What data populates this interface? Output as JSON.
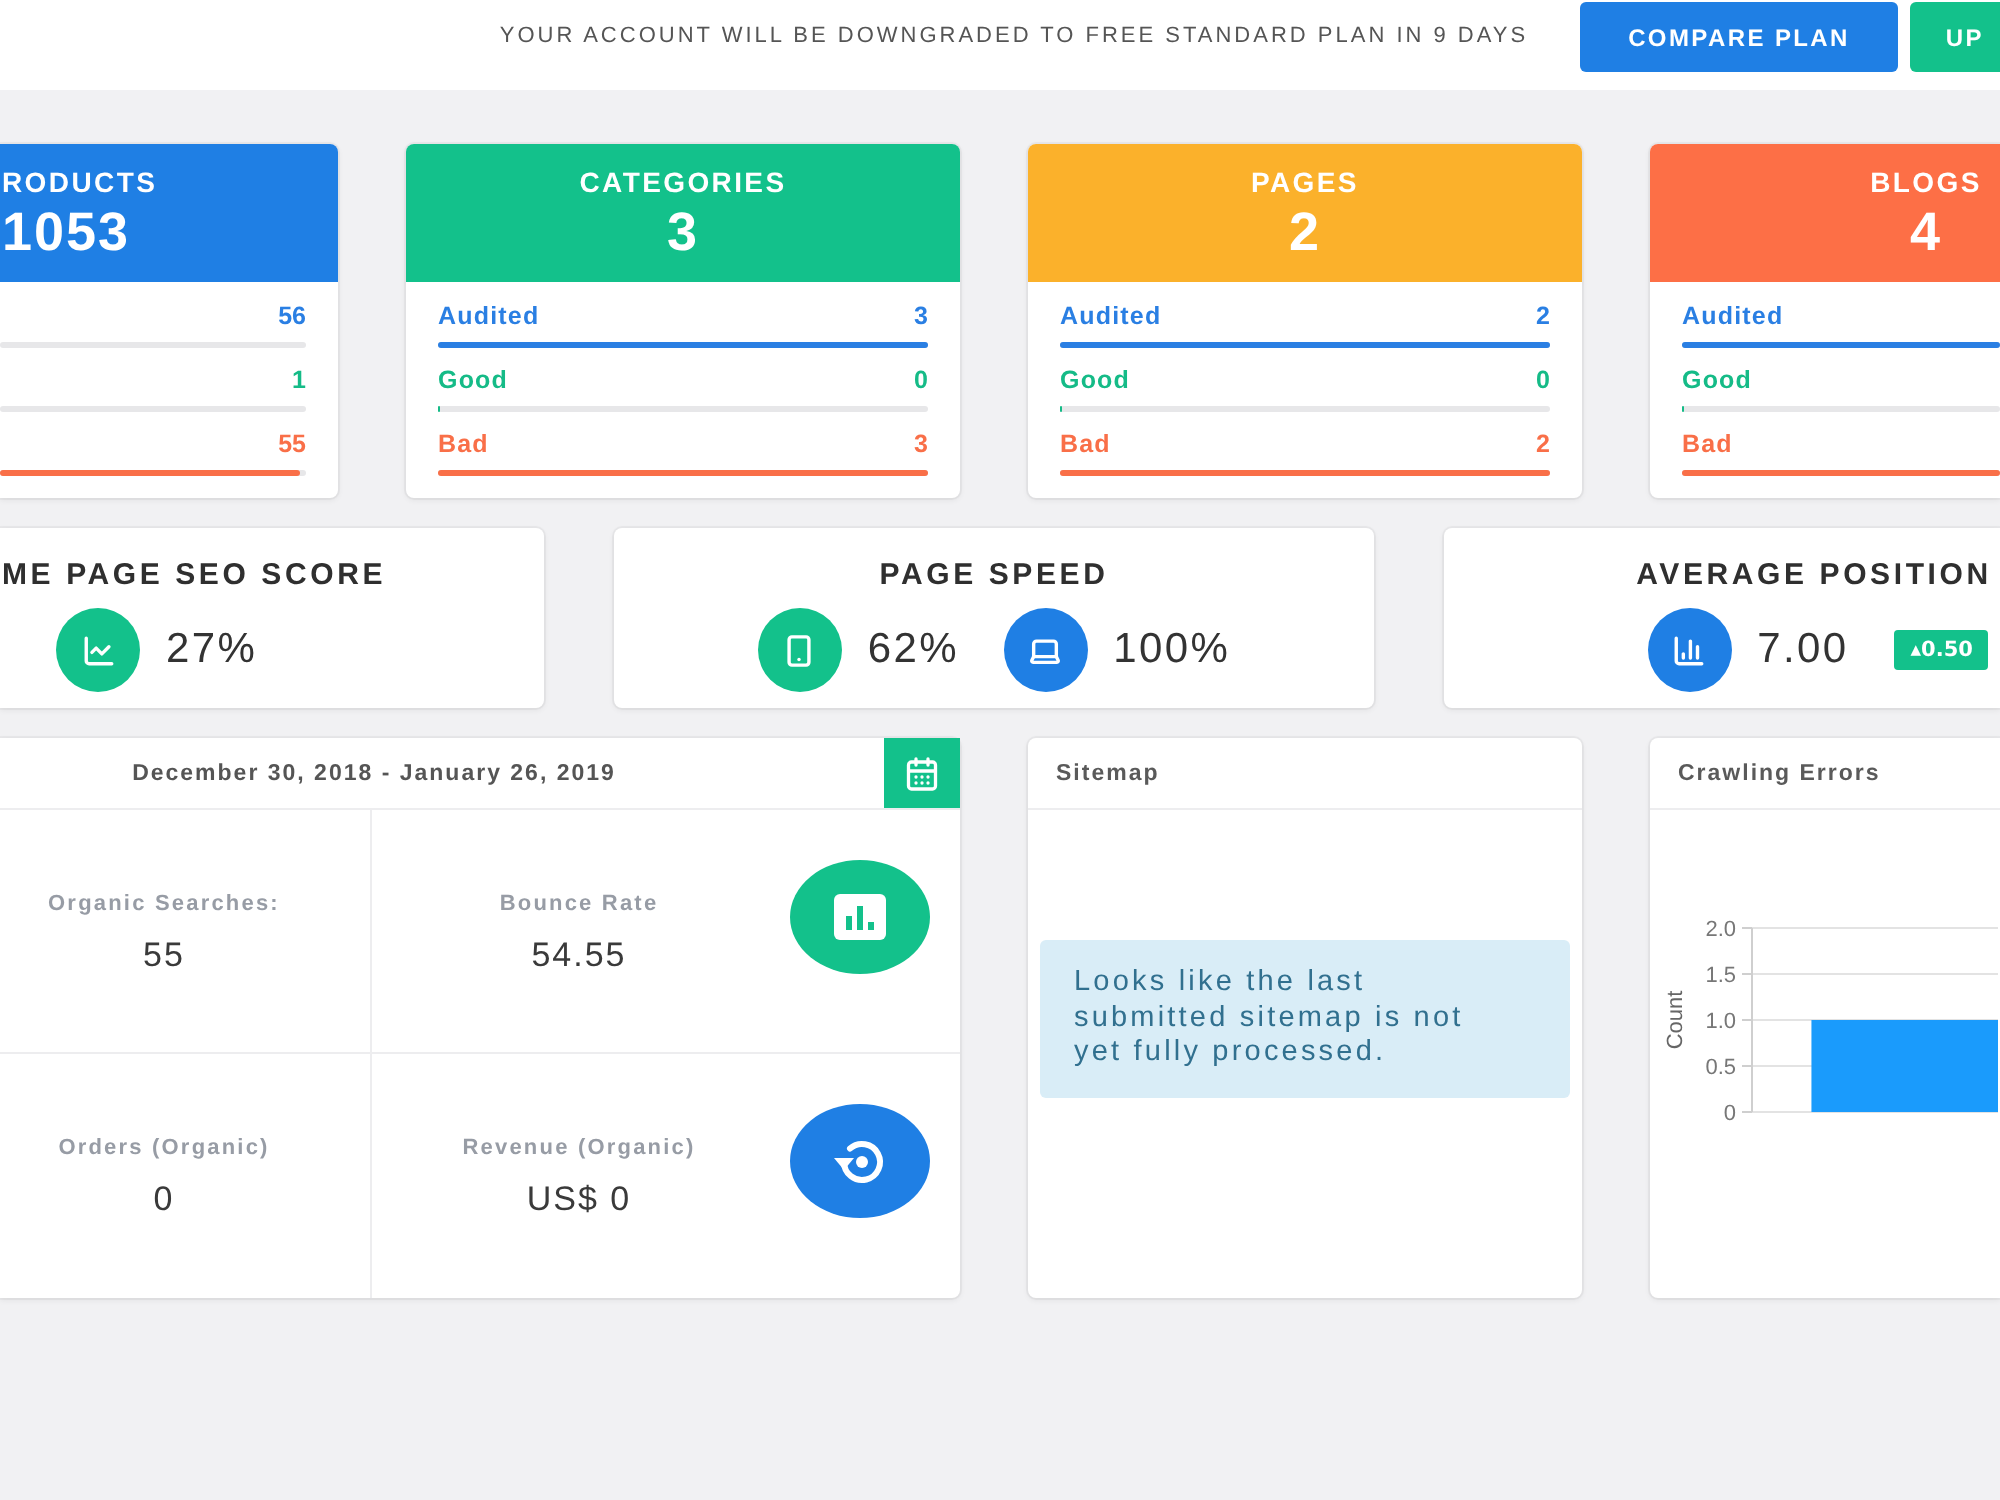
{
  "top_bar": {
    "notice": "YOUR ACCOUNT WILL BE DOWNGRADED TO FREE STANDARD PLAN IN 9 DAYS",
    "buttons": [
      {
        "label": "COMPARE PLAN",
        "color": "#1f7fe4"
      },
      {
        "label": "UP",
        "color": "#13c18b"
      }
    ]
  },
  "summary_cards": [
    {
      "title": "RODUCTS",
      "count": "1053",
      "color": "#1f7fe4",
      "rows": [
        {
          "kind": "audited",
          "value": "56"
        },
        {
          "kind": "good",
          "value": "1"
        },
        {
          "kind": "bad",
          "value": "55",
          "level": 0.98
        }
      ]
    },
    {
      "title": "CATEGORIES",
      "count": "3",
      "color": "#13c18b",
      "rows": [
        {
          "kind": "audited",
          "label": "Audited",
          "value": "3",
          "level": 1
        },
        {
          "kind": "good",
          "label": "Good",
          "value": "0",
          "level": 0
        },
        {
          "kind": "bad",
          "label": "Bad",
          "value": "3",
          "level": 1
        }
      ]
    },
    {
      "title": "PAGES",
      "count": "2",
      "color": "#fbb12b",
      "rows": [
        {
          "kind": "audited",
          "label": "Audited",
          "value": "2",
          "level": 1
        },
        {
          "kind": "good",
          "label": "Good",
          "value": "0",
          "level": 0
        },
        {
          "kind": "bad",
          "label": "Bad",
          "value": "2",
          "level": 1
        }
      ]
    },
    {
      "title": "BLOGS",
      "count": "4",
      "color": "#fd6f46",
      "rows": [
        {
          "kind": "audited",
          "label": "Audited",
          "level": 1
        },
        {
          "kind": "good",
          "label": "Good",
          "level": 0
        },
        {
          "kind": "bad",
          "label": "Bad",
          "level": 1
        }
      ]
    }
  ],
  "score_cards": [
    {
      "title": "ME PAGE SEO SCORE",
      "metrics": [
        {
          "kind": "trend",
          "color": "#13c18b",
          "value": "27%"
        }
      ]
    },
    {
      "title": "PAGE SPEED",
      "metrics": [
        {
          "kind": "mobile",
          "color": "#13c18b",
          "value": "62%"
        },
        {
          "kind": "desktop",
          "color": "#1f7fe4",
          "value": "100%"
        }
      ]
    },
    {
      "title": "AVERAGE POSITION",
      "metrics": [
        {
          "kind": "rank",
          "color": "#1f7fe4",
          "value": "7.00",
          "change": "▴0.50"
        }
      ]
    }
  ],
  "analytics": {
    "date_range": "December 30, 2018 - January 26, 2019",
    "metrics": [
      {
        "label": "Organic Searches:",
        "value": "55"
      },
      {
        "label": "Bounce Rate",
        "value": "54.55"
      },
      {
        "label": "Orders (Organic)",
        "value": "0"
      },
      {
        "label": "Revenue (Organic)",
        "value": "US$ 0"
      }
    ]
  },
  "sitemap": {
    "title": "Sitemap",
    "message": "Looks like the last submitted sitemap is not yet fully processed."
  },
  "crawling_errors": {
    "title": "Crawling Errors",
    "chart_data": {
      "type": "bar",
      "ylabel": "Count",
      "values": [
        1
      ],
      "ylim": [
        0,
        2
      ],
      "yticks": [
        {
          "value": 0,
          "label": "0"
        },
        {
          "value": 0.5,
          "label": "0.5"
        },
        {
          "value": 1,
          "label": "1.0"
        },
        {
          "value": 1.5,
          "label": "1.5"
        },
        {
          "value": 2,
          "label": "2.0"
        }
      ],
      "grid": true
    }
  }
}
